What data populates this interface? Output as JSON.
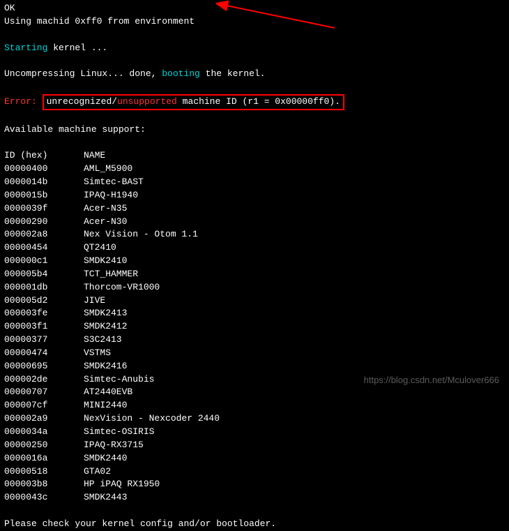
{
  "lines": {
    "ok": "OK",
    "using_machid": "Using machid 0xff0 from environment",
    "starting": "Starting",
    "kernel_dots": " kernel ...",
    "uncompressing": "Uncompressing Linux... done, ",
    "booting": "booting",
    "the_kernel": " the kernel.",
    "error_label": "Error:",
    "error_pre": "unrecognized/",
    "error_red": "unsupported",
    "error_post": " machine ID (r1 = 0x00000ff0).",
    "available": "Available machine support:",
    "header_id": "ID (hex)",
    "header_name": "NAME",
    "please_check": "Please check your kernel config and/or bootloader."
  },
  "machines": [
    {
      "id": "00000400",
      "name": "AML_M5900"
    },
    {
      "id": "0000014b",
      "name": "Simtec-BAST"
    },
    {
      "id": "0000015b",
      "name": "IPAQ-H1940"
    },
    {
      "id": "0000039f",
      "name": "Acer-N35"
    },
    {
      "id": "00000290",
      "name": "Acer-N30"
    },
    {
      "id": "000002a8",
      "name": "Nex Vision - Otom 1.1"
    },
    {
      "id": "00000454",
      "name": "QT2410"
    },
    {
      "id": "000000c1",
      "name": "SMDK2410"
    },
    {
      "id": "000005b4",
      "name": "TCT_HAMMER"
    },
    {
      "id": "000001db",
      "name": "Thorcom-VR1000"
    },
    {
      "id": "000005d2",
      "name": "JIVE"
    },
    {
      "id": "000003fe",
      "name": "SMDK2413"
    },
    {
      "id": "000003f1",
      "name": "SMDK2412"
    },
    {
      "id": "00000377",
      "name": "S3C2413"
    },
    {
      "id": "00000474",
      "name": "VSTMS"
    },
    {
      "id": "00000695",
      "name": "SMDK2416"
    },
    {
      "id": "000002de",
      "name": "Simtec-Anubis"
    },
    {
      "id": "00000707",
      "name": "AT2440EVB"
    },
    {
      "id": "000007cf",
      "name": "MINI2440"
    },
    {
      "id": "000002a9",
      "name": "NexVision - Nexcoder 2440"
    },
    {
      "id": "0000034a",
      "name": "Simtec-OSIRIS"
    },
    {
      "id": "00000250",
      "name": "IPAQ-RX3715"
    },
    {
      "id": "0000016a",
      "name": "SMDK2440"
    },
    {
      "id": "00000518",
      "name": "GTA02"
    },
    {
      "id": "000003b8",
      "name": "HP iPAQ RX1950"
    },
    {
      "id": "0000043c",
      "name": "SMDK2443"
    }
  ],
  "watermark": "https://blog.csdn.net/Mculover666"
}
